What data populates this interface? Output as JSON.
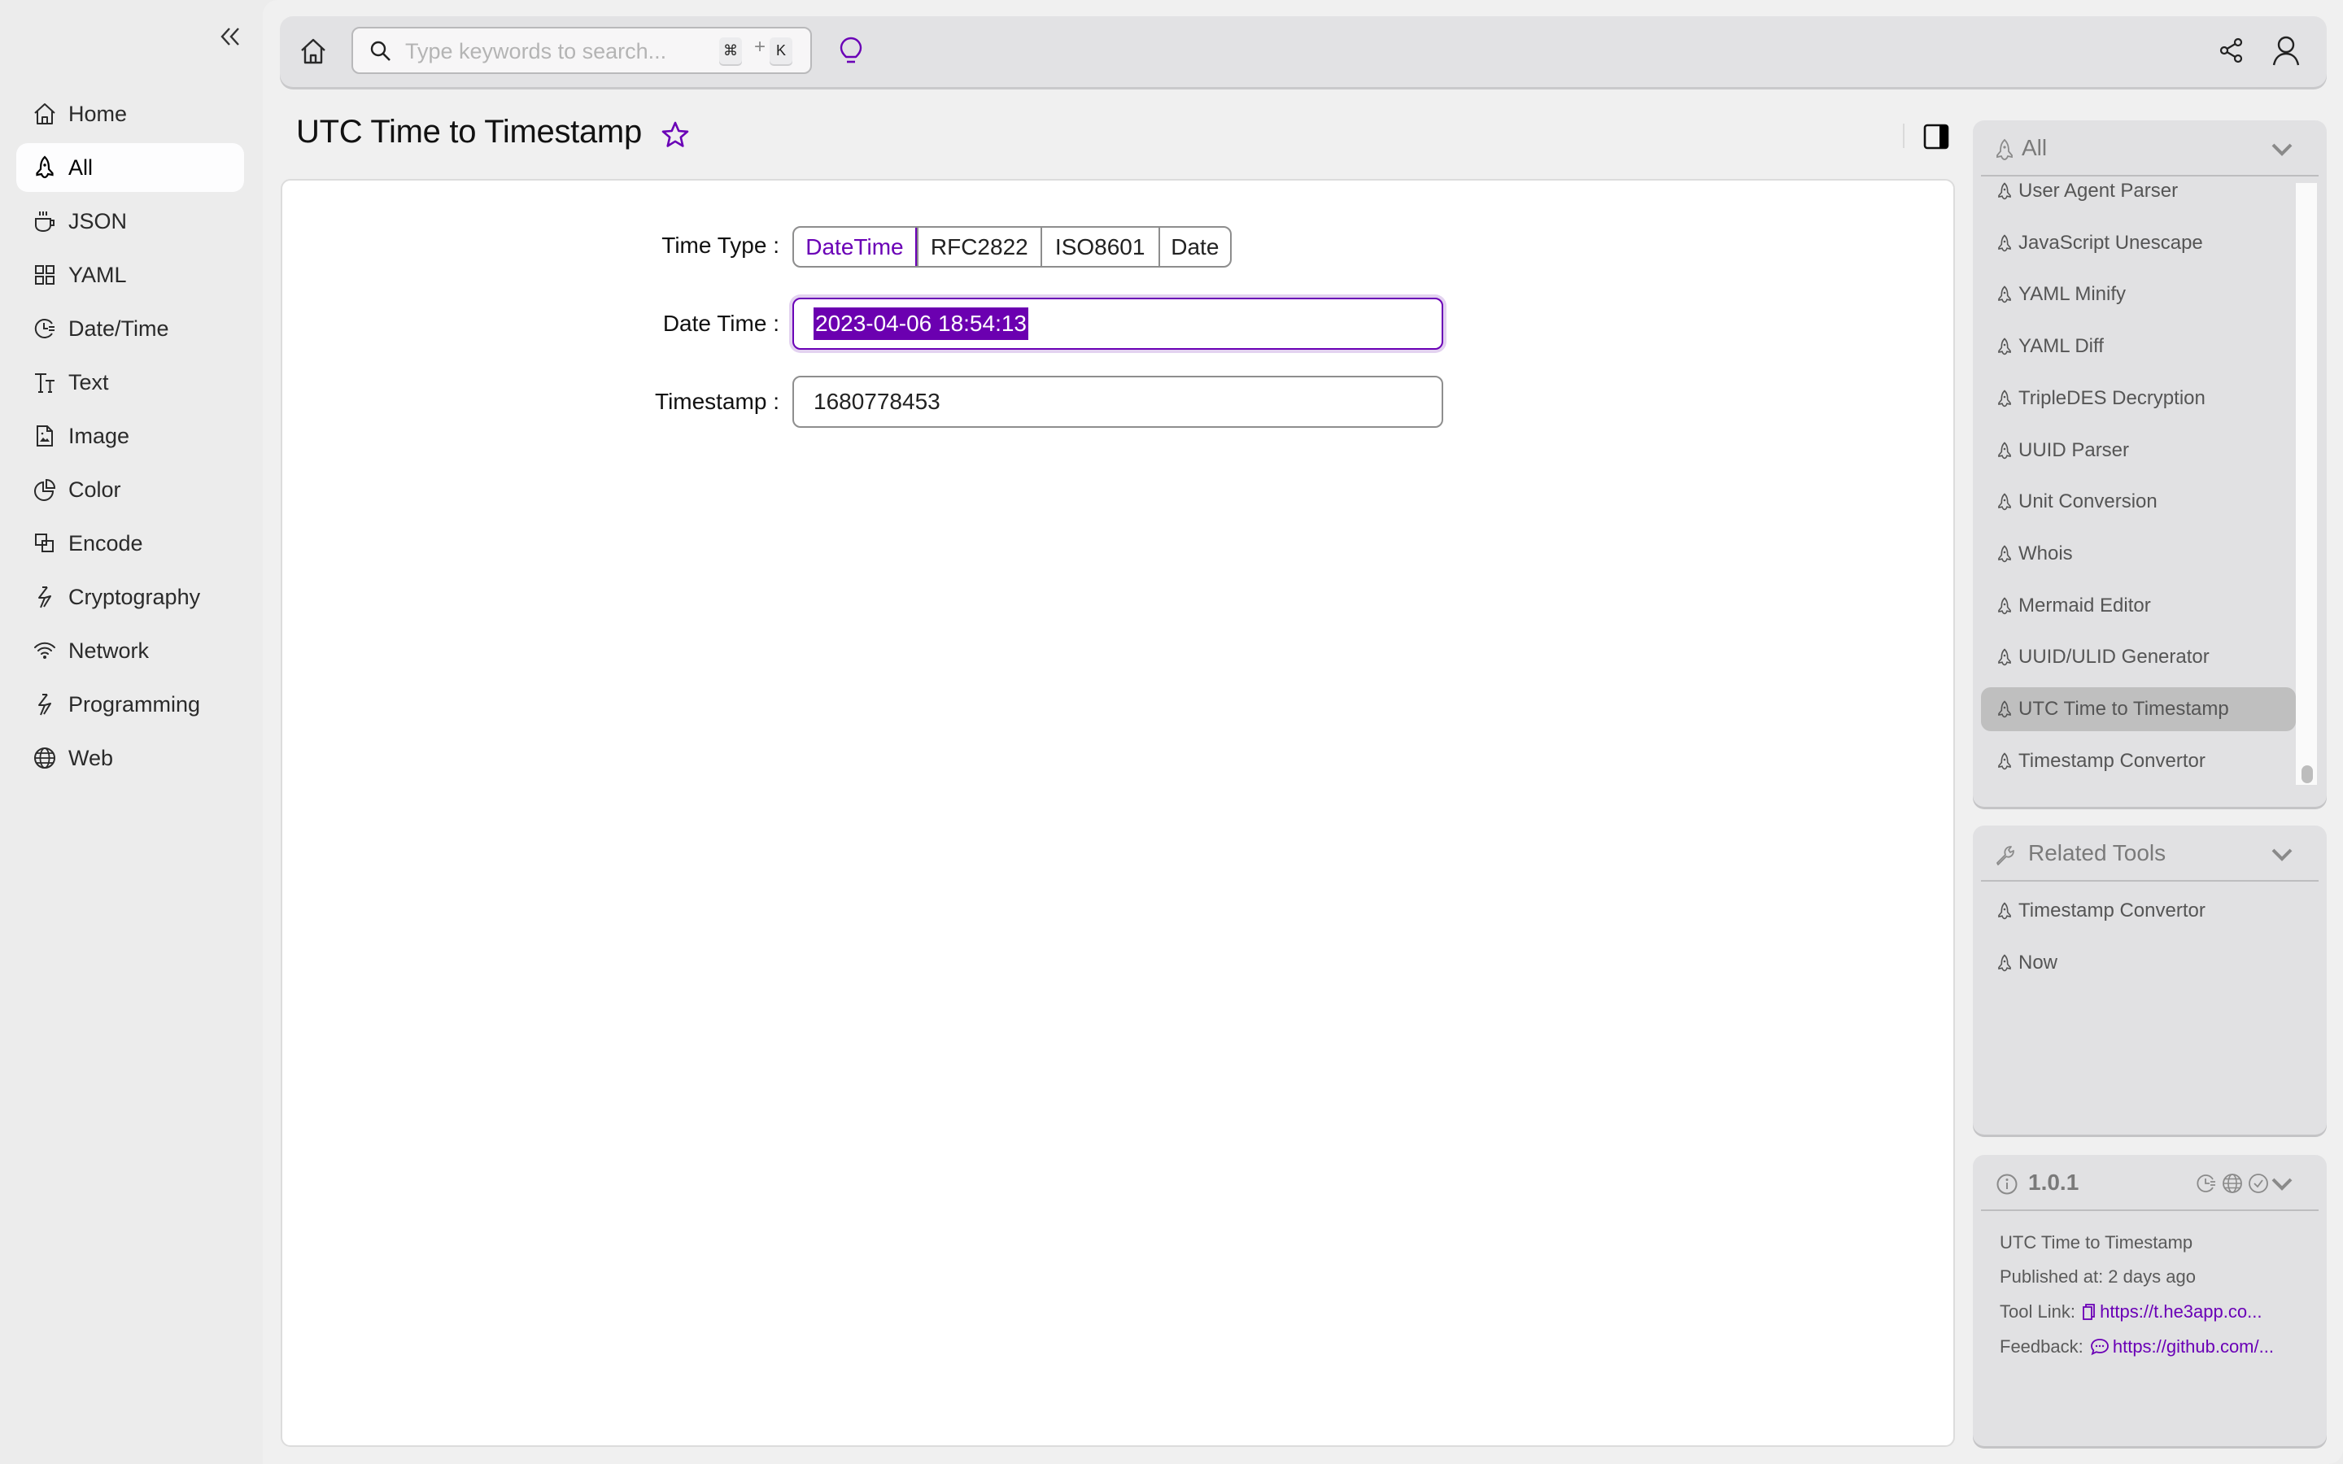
{
  "colors": {
    "accent": "#6a00b6",
    "selection": "#6b00b0",
    "sidebar_bg": "#ececec",
    "main_bg": "#f0f0f0",
    "panel_bg": "#e1e1e3"
  },
  "sidebar": {
    "collapse_icon": "double-chevron-left-icon",
    "items": [
      {
        "label": "Home",
        "icon": "home-icon",
        "active": false
      },
      {
        "label": "All",
        "icon": "rocket-icon",
        "active": true
      },
      {
        "label": "JSON",
        "icon": "coffee-cup-icon",
        "active": false
      },
      {
        "label": "YAML",
        "icon": "grid-icon",
        "active": false
      },
      {
        "label": "Date/Time",
        "icon": "clock-icon",
        "active": false
      },
      {
        "label": "Text",
        "icon": "text-size-icon",
        "active": false
      },
      {
        "label": "Image",
        "icon": "image-file-icon",
        "active": false
      },
      {
        "label": "Color",
        "icon": "pie-chart-icon",
        "active": false
      },
      {
        "label": "Encode",
        "icon": "overlap-squares-icon",
        "active": false
      },
      {
        "label": "Cryptography",
        "icon": "lightning-icon",
        "active": false
      },
      {
        "label": "Network",
        "icon": "wifi-icon",
        "active": false
      },
      {
        "label": "Programming",
        "icon": "lightning-icon",
        "active": false
      },
      {
        "label": "Web",
        "icon": "globe-icon",
        "active": false
      }
    ]
  },
  "topbar": {
    "search": {
      "placeholder": "Type keywords to search...",
      "value": "",
      "shortcut_key1": "⌘",
      "shortcut_plus": "+",
      "shortcut_key2": "K"
    }
  },
  "page": {
    "title": "UTC Time to Timestamp",
    "favorite": false
  },
  "form": {
    "time_type_label": "Time Type",
    "time_types": [
      {
        "label": "DateTime",
        "selected": true
      },
      {
        "label": "RFC2822",
        "selected": false
      },
      {
        "label": "ISO8601",
        "selected": false
      },
      {
        "label": "Date",
        "selected": false
      }
    ],
    "datetime_label": "Date Time",
    "datetime_value": "2023-04-06 18:54:13",
    "timestamp_label": "Timestamp",
    "timestamp_value": "1680778453",
    "colon": ":"
  },
  "right_panel": {
    "all": {
      "title": "All",
      "items": [
        {
          "label": "User Agent Parser",
          "active": false
        },
        {
          "label": "JavaScript Unescape",
          "active": false
        },
        {
          "label": "YAML Minify",
          "active": false
        },
        {
          "label": "YAML Diff",
          "active": false
        },
        {
          "label": "TripleDES Decryption",
          "active": false
        },
        {
          "label": "UUID Parser",
          "active": false
        },
        {
          "label": "Unit Conversion",
          "active": false
        },
        {
          "label": "Whois",
          "active": false
        },
        {
          "label": "Mermaid Editor",
          "active": false
        },
        {
          "label": "UUID/ULID Generator",
          "active": false
        },
        {
          "label": "UTC Time to Timestamp",
          "active": true
        },
        {
          "label": "Timestamp Convertor",
          "active": false
        }
      ]
    },
    "related": {
      "title": "Related Tools",
      "items": [
        {
          "label": "Timestamp Convertor"
        },
        {
          "label": "Now"
        }
      ]
    },
    "info": {
      "version": "1.0.1",
      "tool_name": "UTC Time to Timestamp",
      "published": "Published at: 2 days ago",
      "tool_link_label": "Tool Link:",
      "tool_link_value": "https://t.he3app.co...",
      "feedback_label": "Feedback:",
      "feedback_value": "https://github.com/..."
    }
  }
}
